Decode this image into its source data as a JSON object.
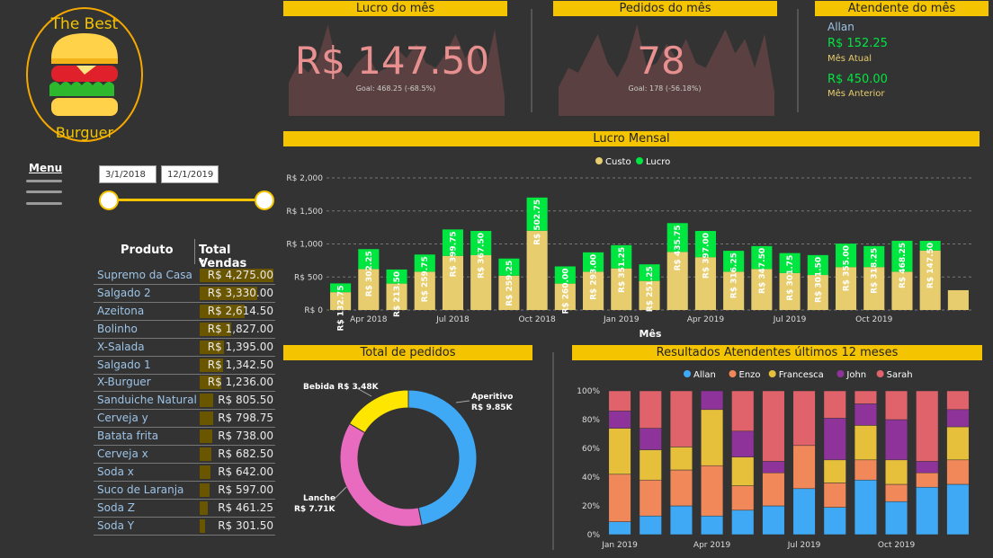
{
  "logo": {
    "line1": "The Best",
    "line2": "Burguer"
  },
  "menu": {
    "label": "Menu"
  },
  "date_range": {
    "start": "3/1/2018",
    "end": "12/1/2019"
  },
  "kpi_lucro": {
    "header": "Lucro do mês",
    "value": "R$ 147.50",
    "goal": "Goal: 468.25 (-68.5%)",
    "trend": [
      0.35,
      0.55,
      0.45,
      0.6,
      0.95,
      0.5,
      0.4,
      0.55,
      0.65,
      0.45,
      0.5,
      0.7,
      0.6,
      0.75,
      0.55,
      0.5,
      0.65,
      0.85,
      0.6,
      0.75,
      0.45,
      0.9,
      0.2
    ]
  },
  "kpi_pedidos": {
    "header": "Pedidos do mês",
    "value": "78",
    "goal": "Goal: 178 (-56.18%)",
    "trend": [
      0.3,
      0.5,
      0.45,
      0.65,
      0.85,
      0.55,
      0.4,
      0.6,
      0.95,
      0.5,
      0.55,
      0.75,
      0.6,
      0.8,
      0.55,
      0.5,
      0.7,
      0.9,
      0.65,
      0.8,
      0.5,
      0.85,
      0.25
    ]
  },
  "atendente": {
    "header": "Atendente do mês",
    "name": "Allan",
    "current_value": "R$ 152.25",
    "current_label": "Mês Atual",
    "previous_value": "R$ 450.00",
    "previous_label": "Mês Anterior"
  },
  "colors": {
    "header": "#F5C400",
    "custo": "#E8CD6E",
    "lucro": "#00E640",
    "bg": "#333333",
    "allan": "#3FA9F5",
    "enzo": "#F0885A",
    "francesca": "#E6C03A",
    "john": "#8E3399",
    "sarah": "#E0636B",
    "pie_aperitivo": "#3FA9F5",
    "pie_lanche": "#E86BC0",
    "pie_bebida": "#FFE600"
  },
  "product_table": {
    "col_produto": "Produto",
    "col_total": "Total Vendas",
    "rows": [
      {
        "name": "Supremo da Casa",
        "value": "R$ 4,275.00",
        "amount": 4275
      },
      {
        "name": "Salgado 2",
        "value": "R$ 3,330.00",
        "amount": 3330
      },
      {
        "name": "Azeitona",
        "value": "R$ 2,614.50",
        "amount": 2614.5
      },
      {
        "name": "Bolinho",
        "value": "R$ 1,827.00",
        "amount": 1827
      },
      {
        "name": "X-Salada",
        "value": "R$ 1,395.00",
        "amount": 1395
      },
      {
        "name": "Salgado 1",
        "value": "R$ 1,342.50",
        "amount": 1342.5
      },
      {
        "name": "X-Burguer",
        "value": "R$ 1,236.00",
        "amount": 1236
      },
      {
        "name": "Sanduiche Natural",
        "value": "R$ 805.50",
        "amount": 805.5
      },
      {
        "name": "Cerveja y",
        "value": "R$ 798.75",
        "amount": 798.75
      },
      {
        "name": "Batata frita",
        "value": "R$ 738.00",
        "amount": 738
      },
      {
        "name": "Cerveja x",
        "value": "R$ 682.50",
        "amount": 682.5
      },
      {
        "name": "Soda x",
        "value": "R$ 642.00",
        "amount": 642
      },
      {
        "name": "Suco de Laranja",
        "value": "R$ 597.00",
        "amount": 597
      },
      {
        "name": "Soda Z",
        "value": "R$ 461.25",
        "amount": 461.25
      },
      {
        "name": "Soda Y",
        "value": "R$ 301.50",
        "amount": 301.5
      }
    ]
  },
  "chart_data": [
    {
      "type": "bar",
      "title": "Lucro Mensal",
      "xlabel": "Mês",
      "ylabel": "",
      "ylim": [
        0,
        2000
      ],
      "yticks": [
        0,
        500,
        1000,
        1500,
        2000
      ],
      "ytick_labels": [
        "R$ 0",
        "R$ 500",
        "R$ 1,000",
        "R$ 1,500",
        "R$ 2,000"
      ],
      "xtick_labels": [
        {
          "index": 1,
          "label": "Apr 2018"
        },
        {
          "index": 4,
          "label": "Jul 2018"
        },
        {
          "index": 7,
          "label": "Oct 2018"
        },
        {
          "index": 10,
          "label": "Jan 2019"
        },
        {
          "index": 13,
          "label": "Apr 2019"
        },
        {
          "index": 16,
          "label": "Jul 2019"
        },
        {
          "index": 19,
          "label": "Oct 2019"
        }
      ],
      "legend": "top-center",
      "series": [
        {
          "name": "Custo",
          "values": [
            270,
            620,
            400,
            580,
            820,
            830,
            520,
            1200,
            400,
            580,
            630,
            440,
            880,
            800,
            580,
            620,
            560,
            530,
            650,
            650,
            580,
            900,
            300
          ]
        },
        {
          "name": "Lucro",
          "values": [
            132.75,
            302.25,
            213.5,
            259.75,
            399.75,
            367.5,
            259.25,
            502.75,
            260.0,
            293.0,
            351.25,
            251.25,
            435.75,
            397.0,
            316.25,
            347.5,
            301.75,
            301.5,
            355.0,
            318.25,
            468.25,
            147.5
          ]
        },
        {
          "name": "Lucro labels",
          "values": [
            "R$ 132.75",
            "R$ 302.25",
            "R$ 213.50",
            "R$ 259.75",
            "R$ 399.75",
            "R$ 367.50",
            "R$ 259.25",
            "R$ 502.75",
            "R$ 260.00",
            "R$ 293.00",
            "R$ 351.25",
            "R$ 251.25",
            "R$ 435.75",
            "R$ 397.00",
            "R$ 316.25",
            "R$ 347.50",
            "R$ 301.75",
            "R$ 301.50",
            "R$ 355.00",
            "R$ 318.25",
            "R$ 468.25",
            "R$ 147.50"
          ]
        }
      ]
    },
    {
      "type": "pie",
      "title": "Total de pedidos",
      "slices": [
        {
          "name": "Aperitivo",
          "value": 9.85,
          "label": "Aperitivo",
          "value_label": "R$ 9.85K"
        },
        {
          "name": "Lanche",
          "value": 7.71,
          "label": "Lanche",
          "value_label": "R$ 7.71K"
        },
        {
          "name": "Bebida",
          "value": 3.48,
          "label": "Bebida",
          "value_label": "R$ 3.48K"
        }
      ]
    },
    {
      "type": "bar",
      "title": "Resultados Atendentes últimos 12 meses",
      "stacked": "percent",
      "ylim": [
        0,
        100
      ],
      "ytick_labels": [
        "0%",
        "20%",
        "40%",
        "60%",
        "80%",
        "100%"
      ],
      "xtick_labels": [
        {
          "index": 0,
          "label": "Jan 2019"
        },
        {
          "index": 3,
          "label": "Apr 2019"
        },
        {
          "index": 6,
          "label": "Jul 2019"
        },
        {
          "index": 9,
          "label": "Oct 2019"
        }
      ],
      "legend": "top-center",
      "series": [
        {
          "name": "Allan",
          "values": [
            9,
            13,
            20,
            13,
            17,
            20,
            32,
            19,
            38,
            23,
            33,
            35
          ]
        },
        {
          "name": "Enzo",
          "values": [
            33,
            25,
            25,
            35,
            17,
            23,
            30,
            17,
            14,
            12,
            10,
            17
          ]
        },
        {
          "name": "Francesca",
          "values": [
            32,
            21,
            16,
            39,
            20,
            0,
            0,
            16,
            24,
            17,
            0,
            23
          ]
        },
        {
          "name": "John",
          "values": [
            12,
            15,
            0,
            13,
            18,
            8,
            0,
            29,
            15,
            28,
            8,
            12
          ]
        },
        {
          "name": "Sarah",
          "values": [
            14,
            26,
            39,
            0,
            28,
            49,
            38,
            19,
            9,
            20,
            49,
            13
          ]
        }
      ]
    }
  ]
}
